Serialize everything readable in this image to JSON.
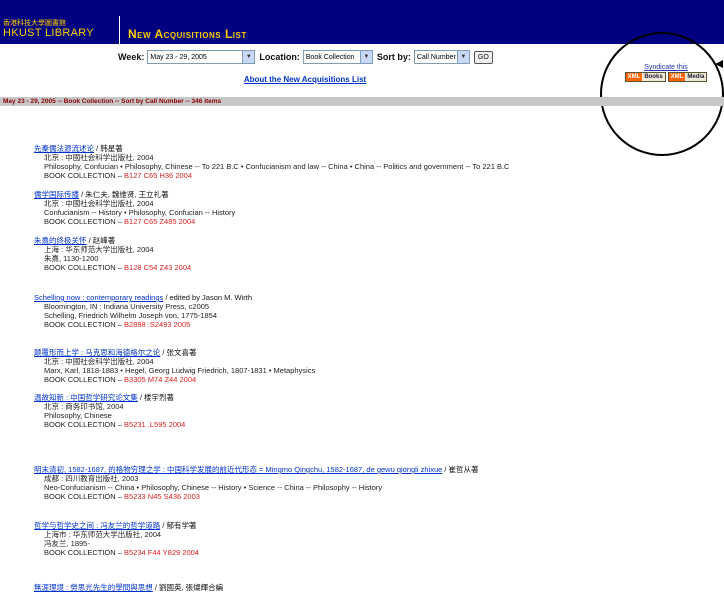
{
  "header": {
    "library_name_zh": "香港科技大學圖書館",
    "library_name_en": "HKUST LIBRARY",
    "title": "New Acquisitions List"
  },
  "controls": {
    "week_label": "Week:",
    "week_value": "May 23 - 29, 2005",
    "location_label": "Location:",
    "location_value": "Book Collection",
    "sort_label": "Sort by:",
    "sort_value": "Call Number",
    "go_label": "GO"
  },
  "about_link": "About the New Acquisitions List",
  "syndicate": {
    "label": "Syndicate this",
    "books": "Books",
    "media": "Media",
    "badge_prefix": "XML"
  },
  "summary_bar": "May 23 - 29, 2005 -- Book Collection -- Sort by Call Number -- 346 items",
  "entries": [
    {
      "title": "先秦儒法源流述论",
      "author": " / 韩星著",
      "lines": [
        "北京 : 中國社会科学出版社, 2004",
        "Philosophy, Confucian • Philosophy, Chinese -- To 221 B.C • Confucianism and law -- China • China -- Politics and government -- To 221 B.C"
      ],
      "collection": "BOOK COLLECTION – ",
      "call": "B127 C65 H36 2004"
    },
    {
      "title": "儒学国际传播",
      "author": " / 朱仁夫, 魏维贤, 王立礼著",
      "lines": [
        "北京 : 中國社会科学出版社, 2004",
        "Confucianism -- History • Philosophy, Confucian -- History"
      ],
      "collection": "BOOK COLLECTION – ",
      "call": "B127 C65 Z485 2004"
    },
    {
      "title": "朱熹的终极关怀",
      "author": " / 赵峰著",
      "lines": [
        "上海 : 华东师范大学出版社, 2004",
        "朱熹, 1130-1200"
      ],
      "collection": "BOOK COLLECTION – ",
      "call": "B128 C54 Z43 2004"
    },
    {
      "title": "Schelling now : contemporary readings",
      "author": " / edited by Jason M. Wirth",
      "lines": [
        "Bloomington, IN : Indiana University Press, c2005",
        "Schelling, Friedrich Wilhelm Joseph von, 1775-1854"
      ],
      "collection": "BOOK COLLECTION – ",
      "call": "B2898 .S2493 2005"
    },
    {
      "title": "颠覆形而上学 : 马克思和海德格尔之论",
      "author": " / 张文喜著",
      "lines": [
        "北京 : 中國社会科学出版社, 2004",
        "Marx, Karl, 1818-1883 • Hegel, Georg Ludwig Friedrich, 1807-1831 • Metaphysics"
      ],
      "collection": "BOOK COLLECTION – ",
      "call": "B3305 M74 Z44 2004"
    },
    {
      "title": "温故知新 : 中国哲学研究论文集",
      "author": " / 楼宇烈著",
      "lines": [
        "北京 : 商务印书馆, 2004",
        "Philosophy, Chinese"
      ],
      "collection": "BOOK COLLECTION – ",
      "call": "B5231 .L595 2004"
    },
    {
      "title": "明末清初, 1582-1687, 的格物穷理之学 : 中国科学发展的前近代形态 = Mingmo Qingchu, 1582-1687, de gewu qiongli zhixue",
      "author": " / 崔哲从著",
      "lines": [
        "成都 : 四川教育出版社, 2003",
        "Neo-Confucianism -- China • Philosophy, Chinese -- History • Science -- China -- Philosophy -- History"
      ],
      "collection": "BOOK COLLECTION – ",
      "call": "B5233 N45 S436 2003"
    },
    {
      "title": "哲学与哲学史之间 : 冯友兰的哲学道路",
      "author": " / 郁有学著",
      "lines": [
        "上海市 : 华东师范大学出版社, 2004",
        "冯友兰, 1895-"
      ],
      "collection": "BOOK COLLECTION – ",
      "call": "B5234 F44 Y829 2004"
    },
    {
      "title": "無涯理境 : 勞思光先生的學問與思想",
      "author": " / 劉國英, 張燦輝合編",
      "lines": [],
      "collection": "",
      "call": ""
    }
  ]
}
